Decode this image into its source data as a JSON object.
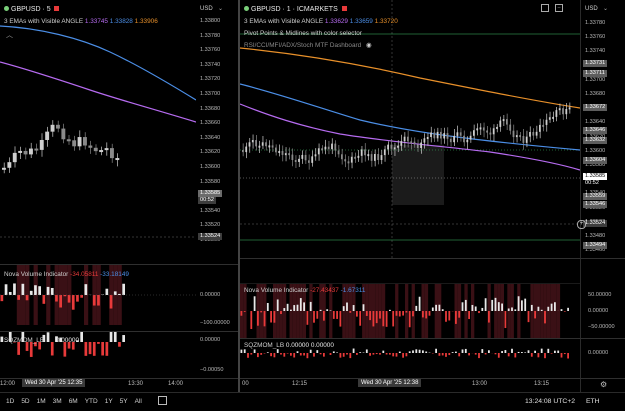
{
  "left_chart": {
    "symbol_legend": "GBPUSD · 5",
    "ema_legend": "3 EMAs with Visible ANGLE",
    "ema_values": [
      "1.33745",
      "1.33828",
      "1.33906"
    ],
    "currency": "USD",
    "price_ticks": [
      "1.33800",
      "1.33780",
      "1.33760",
      "1.33740",
      "1.33720",
      "1.33700",
      "1.33680",
      "1.33660",
      "1.33640",
      "1.33620",
      "1.33600",
      "1.33580",
      "1.33560",
      "1.33540",
      "1.33520",
      "1.33500"
    ],
    "price_label": "1.33585",
    "price_countdown": "00:52",
    "cross_price": "1.33524",
    "nova_legend": "Nova Volume Indicator",
    "nova_values": [
      "-34.05811",
      "-33.18149"
    ],
    "nova_ticks": [
      "0.00000",
      "−100.00000"
    ],
    "sqz_legend": "SQZMOM_LB",
    "sqz_values": [
      "0.00000"
    ],
    "sqz_ticks": [
      "0.00000",
      "−0.00050"
    ],
    "time_ticks": [
      "12:00",
      "13:30",
      "14:00"
    ],
    "cross_time": "Wed 30 Apr '25  12:35"
  },
  "right_chart": {
    "symbol_legend": "GBPUSD · 1 · ICMARKETS",
    "ema_legend": "3 EMAs with Visible ANGLE",
    "ema_values": [
      "1.33629",
      "1.33659",
      "1.33720"
    ],
    "pivot_legend": "Pivot Points & Midlines with color selector",
    "rsi_legend": "RSI/CCI/MFI/ADX/Stoch MTF Dashboard",
    "currency": "USD",
    "price_ticks": [
      "1.33780",
      "1.33760",
      "1.33740",
      "1.33720",
      "1.33700",
      "1.33680",
      "1.33660",
      "1.33640",
      "1.33620",
      "1.33600",
      "1.33580",
      "1.33560",
      "1.33540",
      "1.33520",
      "1.33500",
      "1.33480",
      "1.33460"
    ],
    "badges": [
      "1.33731",
      "1.33711",
      "1.33672",
      "1.33646",
      "1.33632",
      "1.33604",
      "1.33559",
      "1.33546",
      "1.33494"
    ],
    "price_label": "1.33585",
    "price_countdown": "00:52",
    "cross_price": "1.33524",
    "nova_legend": "Nova Volume Indicator",
    "nova_values": [
      "-27.43437",
      "-1.67311"
    ],
    "nova_ticks": [
      "50.00000",
      "0.00000",
      "−50.00000"
    ],
    "sqz_legend": "SQZMOM_LB",
    "sqz_values": [
      "0.00000",
      "0.00000"
    ],
    "sqz_ticks": [
      "0.00000"
    ],
    "time_ticks": [
      "00",
      "12:15",
      "13:00",
      "13:15"
    ],
    "cross_time": "Wed 30 Apr '25  12:38"
  },
  "bottom_bar": {
    "ranges": [
      "1D",
      "5D",
      "1M",
      "3M",
      "6M",
      "YTD",
      "1Y",
      "5Y",
      "All"
    ],
    "clock": "13:24:08 UTC+2",
    "currency": "ETH"
  },
  "colors": {
    "ema_fast": "#b66bf0",
    "ema_mid": "#4b8ee6",
    "ema_slow": "#e8902a",
    "nova_pos": "#4b8ee6",
    "nova_neg": "#e83a3a",
    "pivot_green": "#3ec06a",
    "bear_body": "#cfcfcf",
    "bull_body": "#8a8a8a"
  }
}
